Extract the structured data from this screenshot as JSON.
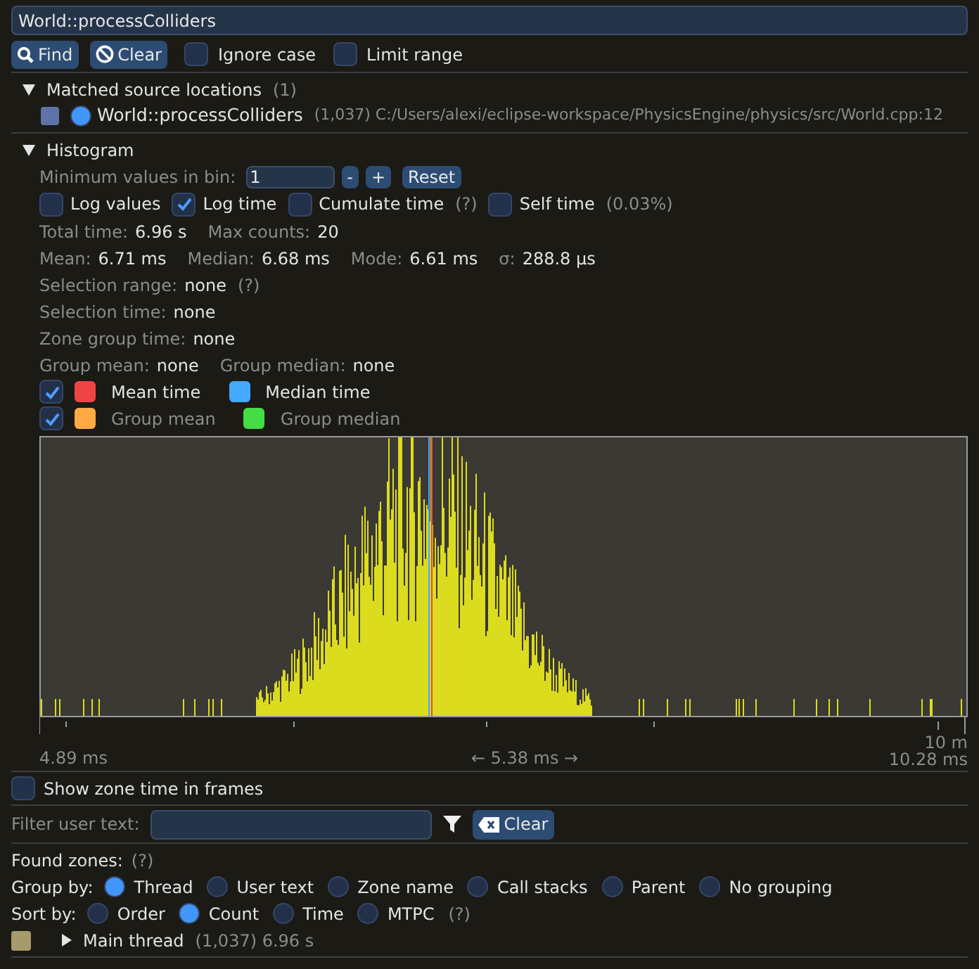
{
  "search": {
    "value": "World::processColliders"
  },
  "toolbar": {
    "buttons": [
      {
        "kind": "find",
        "label": "Find"
      },
      {
        "kind": "clear",
        "label": "Clear"
      }
    ],
    "options": [
      {
        "label": "Ignore case",
        "checked": false
      },
      {
        "label": "Limit range",
        "checked": false
      }
    ]
  },
  "matched": {
    "title": "Matched source locations",
    "count": "(1)",
    "expanded": true,
    "items": [
      {
        "color": "#5e73a8",
        "selected": true,
        "name": "World::processColliders",
        "count": "(1,037)",
        "path": "C:/Users/alexi/eclipse-workspace/PhysicsEngine/physics/src/World.cpp:12"
      }
    ]
  },
  "histogram": {
    "title": "Histogram",
    "expanded": true,
    "min_label": "Minimum values in bin:",
    "min_value": "1",
    "buttons": [
      "-",
      "+",
      "Reset"
    ],
    "options": [
      {
        "label": "Log values",
        "checked": false
      },
      {
        "label": "Log time",
        "checked": true
      },
      {
        "label": "Cumulate time",
        "checked": false,
        "hint": "(?)"
      },
      {
        "label": "Self time",
        "checked": false,
        "hint": "(0.03%)"
      }
    ],
    "stats": [
      [
        {
          "label": "Total time:",
          "value": "6.96 s"
        },
        {
          "label": "Max counts:",
          "value": "20"
        }
      ],
      [
        {
          "label": "Mean:",
          "value": "6.71 ms"
        },
        {
          "label": "Median:",
          "value": "6.68 ms"
        },
        {
          "label": "Mode:",
          "value": "6.61 ms"
        },
        {
          "label": "σ:",
          "value": "288.8 μs"
        }
      ],
      [
        {
          "label": "Selection range:",
          "value": "none",
          "hint": "(?)"
        }
      ],
      [
        {
          "label": "Selection time:",
          "value": "none"
        }
      ],
      [
        {
          "label": "Zone group time:",
          "value": "none"
        }
      ],
      [
        {
          "label": "Group mean:",
          "value": "none"
        },
        {
          "label": "Group median:",
          "value": "none"
        }
      ]
    ],
    "legend": [
      {
        "checked": true,
        "items": [
          {
            "label": "Mean time",
            "color": "#ee4444",
            "disabled": false
          },
          {
            "label": "Median time",
            "color": "#44aaff",
            "disabled": false
          }
        ]
      },
      {
        "checked": true,
        "items": [
          {
            "label": "Group mean",
            "color": "#ffaa44",
            "disabled": true
          },
          {
            "label": "Group median",
            "color": "#44dd44",
            "disabled": true
          }
        ]
      }
    ],
    "axis": {
      "min": "4.89 ms",
      "range": "← 5.38 ms →",
      "max": "10.28 ms",
      "tick_label": "10 m"
    }
  },
  "frames_option": {
    "label": "Show zone time in frames",
    "checked": false
  },
  "filter": {
    "label": "Filter user text:",
    "clear": "Clear"
  },
  "found": {
    "label": "Found zones:",
    "hint": "(?)"
  },
  "group_by": {
    "label": "Group by:",
    "options": [
      {
        "label": "Thread",
        "selected": true
      },
      {
        "label": "User text",
        "selected": false
      },
      {
        "label": "Zone name",
        "selected": false
      },
      {
        "label": "Call stacks",
        "selected": false
      },
      {
        "label": "Parent",
        "selected": false
      },
      {
        "label": "No grouping",
        "selected": false
      }
    ]
  },
  "sort_by": {
    "label": "Sort by:",
    "hint": "(?)",
    "options": [
      {
        "label": "Order",
        "selected": false
      },
      {
        "label": "Count",
        "selected": true
      },
      {
        "label": "Time",
        "selected": false
      },
      {
        "label": "MTPC",
        "selected": false
      }
    ]
  },
  "zones": [
    {
      "color": "#a89a6a",
      "expanded": false,
      "name": "Main thread",
      "info": "(1,037) 6.96 s"
    }
  ]
}
